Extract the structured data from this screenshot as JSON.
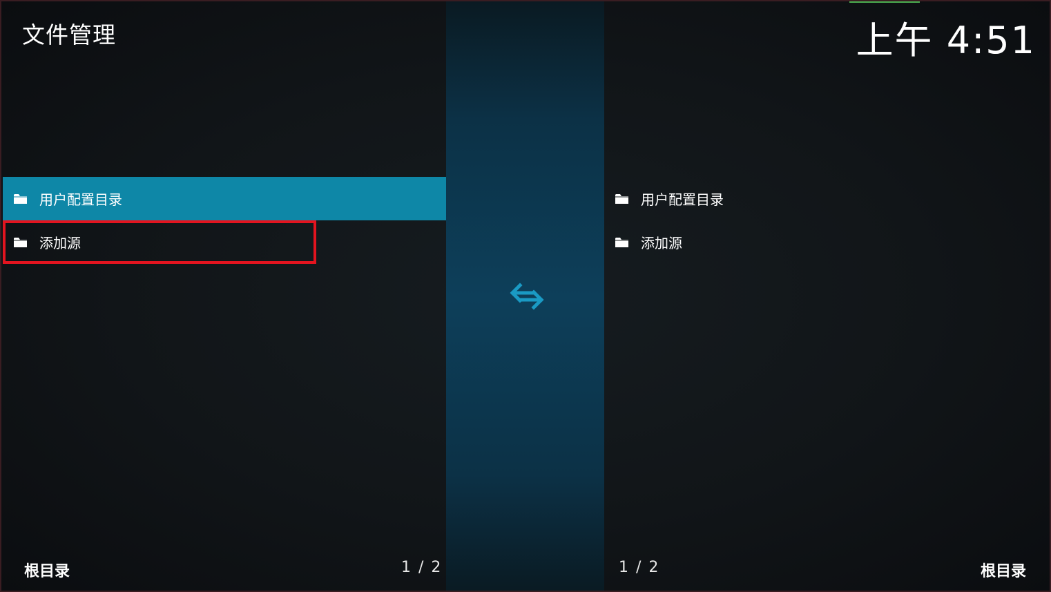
{
  "header": {
    "title": "文件管理",
    "clock": "上午 4:51"
  },
  "colors": {
    "focus_bg": "#0e87a7",
    "highlight_border": "#e3141f",
    "swap_arrow": "#1a9ac4",
    "divider": "#0d3f5a"
  },
  "left_pane": {
    "items": [
      {
        "label": "用户配置目录",
        "icon": "folder-icon"
      },
      {
        "label": "添加源",
        "icon": "folder-icon"
      }
    ],
    "footer_label": "根目录",
    "page_count": "1 / 2"
  },
  "right_pane": {
    "items": [
      {
        "label": "用户配置目录",
        "icon": "folder-icon"
      },
      {
        "label": "添加源",
        "icon": "folder-icon"
      }
    ],
    "footer_label": "根目录",
    "page_count": "1 / 2"
  },
  "center": {
    "icon": "swap-arrows-icon"
  }
}
